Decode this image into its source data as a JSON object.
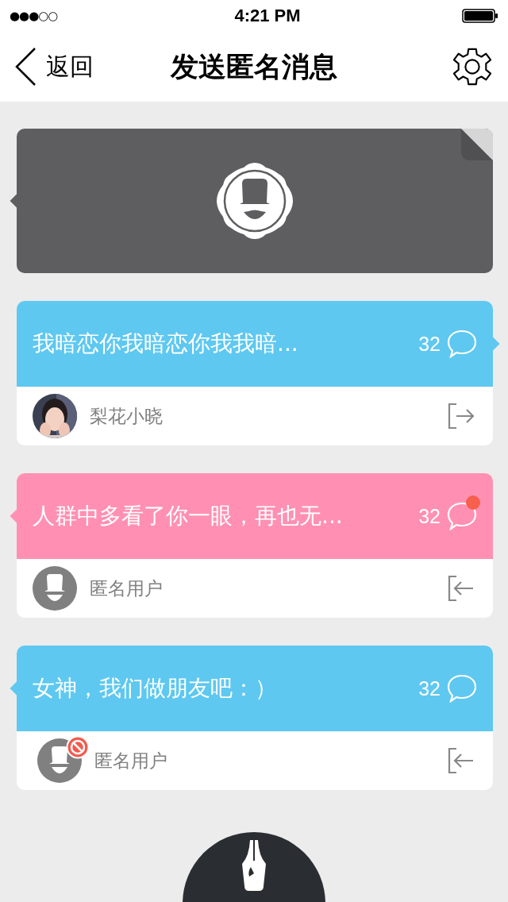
{
  "status_bar": {
    "signal_dots": "●●●○○",
    "time": "4:21 PM"
  },
  "nav": {
    "back_label": "返回",
    "title": "发送匿名消息"
  },
  "messages": [
    {
      "text": "我暗恋你我暗恋你我我暗...",
      "count": "32",
      "color": "#5ec8f0",
      "pointer_right": true,
      "unread": false,
      "author": "梨花小晓",
      "anonymous": false,
      "blocked": false,
      "incoming": false
    },
    {
      "text": "人群中多看了你一眼，再也无...",
      "count": "32",
      "color": "#ff90b4",
      "pointer_right": false,
      "unread": true,
      "author": "匿名用户",
      "anonymous": true,
      "blocked": false,
      "incoming": true
    },
    {
      "text": "女神，我们做朋友吧：）",
      "count": "32",
      "color": "#5ec8f0",
      "pointer_right": false,
      "unread": false,
      "author": "匿名用户",
      "anonymous": true,
      "blocked": true,
      "incoming": true
    }
  ]
}
